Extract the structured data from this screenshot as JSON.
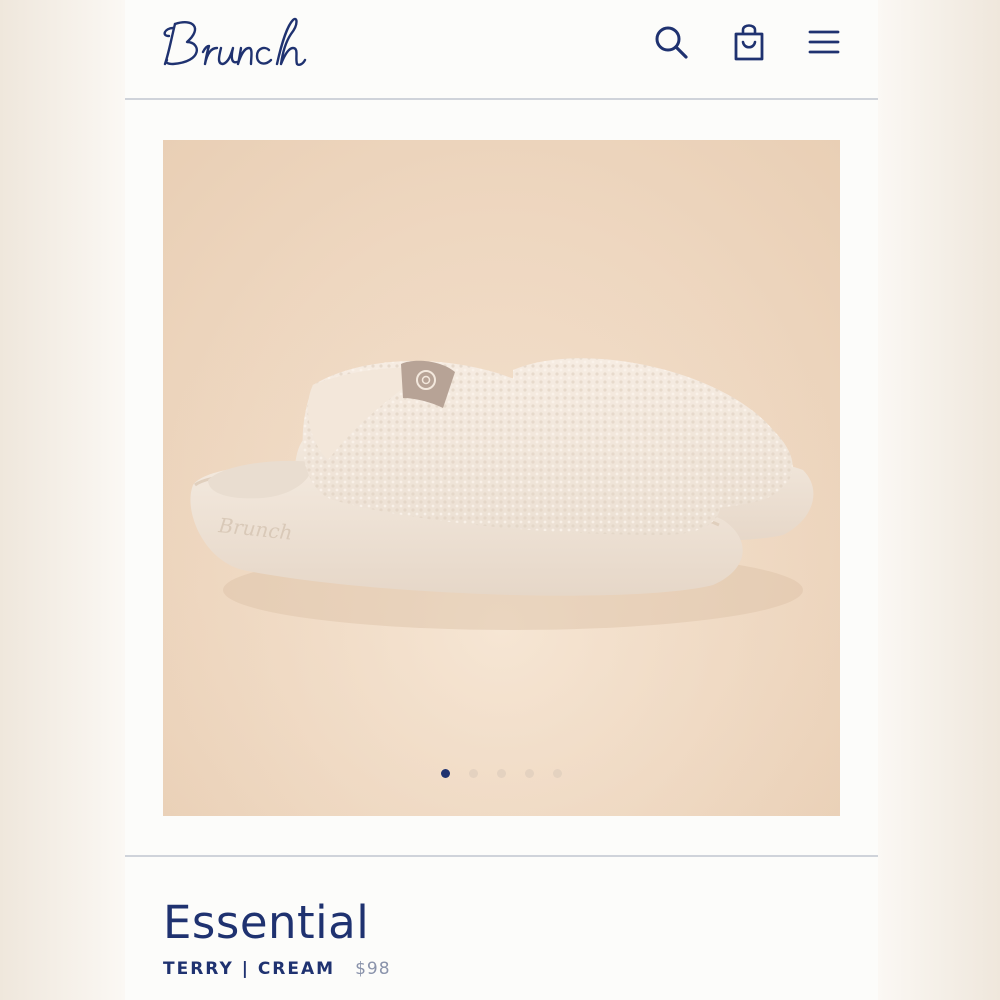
{
  "brand": {
    "logo_text": "Brunch",
    "color": "#1f3270"
  },
  "header": {
    "icons": [
      "search-icon",
      "shopping-bag-icon",
      "menu-icon"
    ]
  },
  "gallery": {
    "image": "cream terry slide slippers on a peach background",
    "slide_count": 5,
    "active_slide": 1,
    "embossed_text": "Brunch"
  },
  "product": {
    "name": "Essential",
    "variant": "TERRY | CREAM",
    "price": "$98"
  },
  "colors": {
    "accent": "#1f3270",
    "muted": "#8a93ab",
    "background": "#fcfcfa",
    "photo_bg": "#eed7c0"
  }
}
